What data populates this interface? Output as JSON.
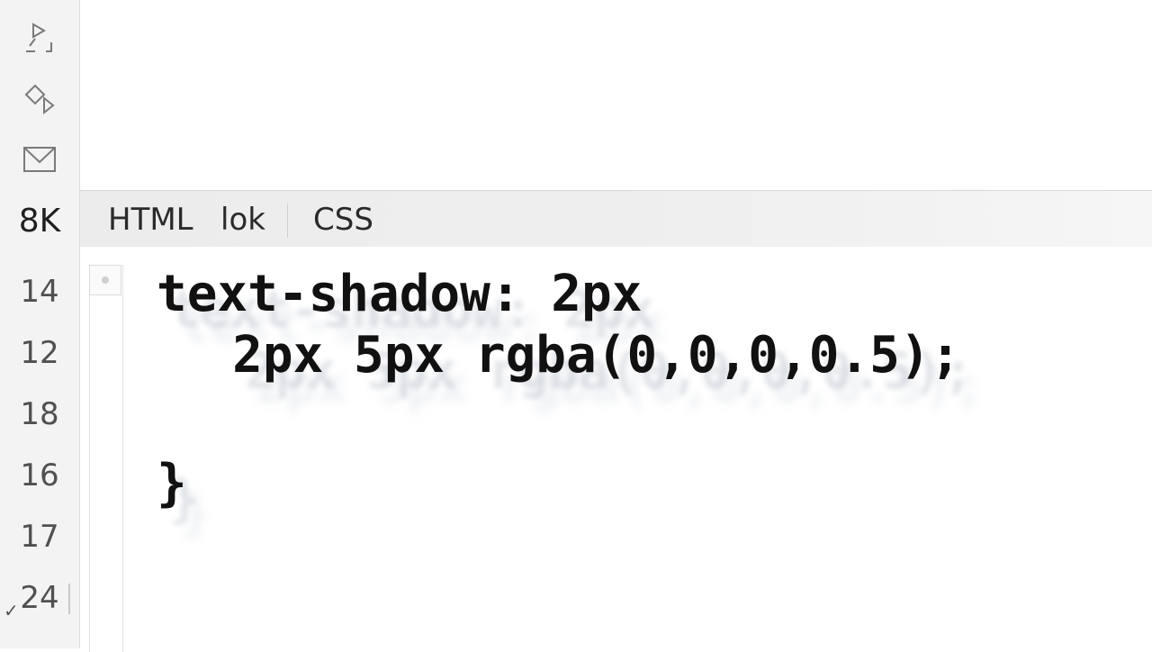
{
  "gutter": {
    "icons": [
      "pen-tool-icon",
      "paint-bucket-icon",
      "mail-icon"
    ],
    "line_numbers": [
      "8K",
      "14",
      "12",
      "18",
      "16",
      "17",
      "24"
    ]
  },
  "tabs": [
    "HTML",
    "lok",
    "CSS"
  ],
  "code": {
    "line1": "text-shadow: 2px",
    "line2": "   2px 5px rgba(0,0,0,0.5);",
    "line3": "}"
  }
}
